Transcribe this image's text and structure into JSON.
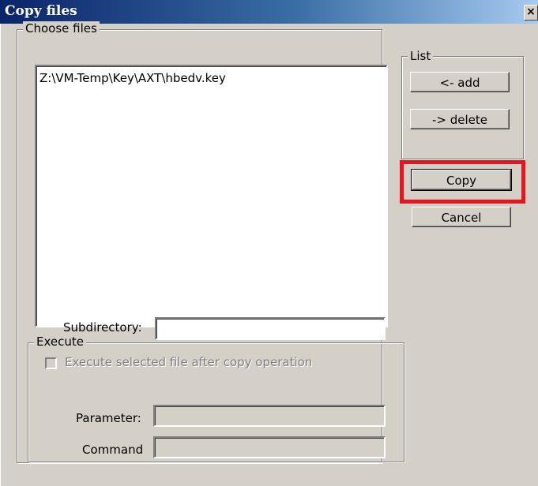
{
  "window": {
    "title": "Copy files",
    "close_label": "×"
  },
  "choose_files": {
    "legend": "Choose files",
    "files": [
      "Z:\\VM-Temp\\Key\\AXT\\hbedv.key"
    ],
    "subdirectory_label": "Subdirectory:",
    "subdirectory_value": ""
  },
  "list_group": {
    "legend": "List",
    "add_label": "<- add",
    "delete_label": "-> delete"
  },
  "actions": {
    "copy_label": "Copy",
    "cancel_label": "Cancel"
  },
  "execute": {
    "legend": "Execute",
    "checkbox_label": "Execute selected file after copy operation",
    "checkbox_checked": false,
    "parameter_label": "Parameter:",
    "parameter_value": "",
    "command_label": "Command",
    "command_value": ""
  },
  "colors": {
    "highlight": "#e8141e",
    "title_bar": "#0a246a"
  }
}
